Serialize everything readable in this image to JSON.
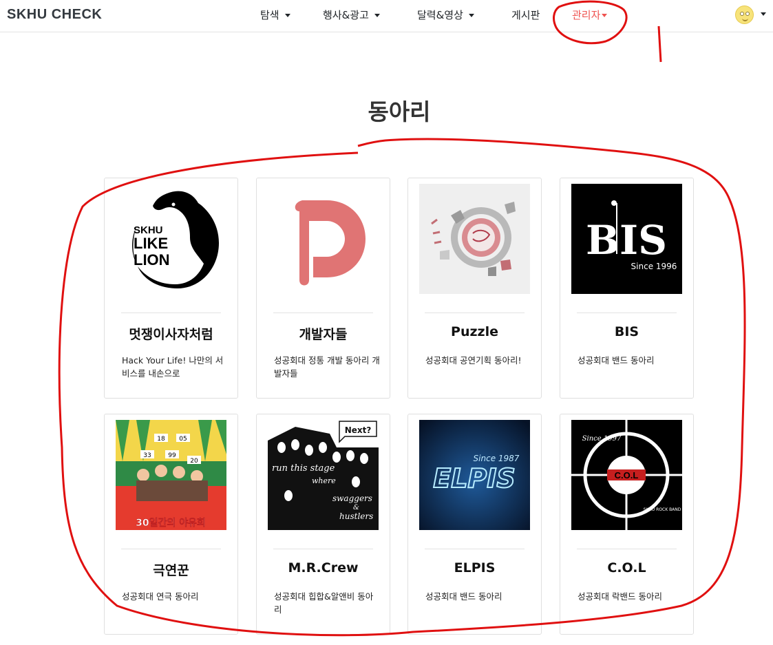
{
  "navbar": {
    "brand": "SKHU CHECK",
    "items": [
      {
        "label": "탐색",
        "dropdown": true
      },
      {
        "label": "행사&광고",
        "dropdown": true
      },
      {
        "label": "달력&영상",
        "dropdown": true
      },
      {
        "label": "게시판",
        "dropdown": false
      },
      {
        "label": "관리자",
        "dropdown": true,
        "active": true
      }
    ],
    "avatar_icon": "smiley-avatar-icon",
    "accent_color": "#ef5350"
  },
  "page": {
    "title": "동아리"
  },
  "clubs": [
    {
      "name": "멋쟁이사자처럼",
      "desc": "Hack Your Life! 나만의 서비스를 내손으로",
      "logo_text": [
        "SKHU",
        "LIKE",
        "LION"
      ]
    },
    {
      "name": "개발자들",
      "desc": "성공회대 정통 개발 동아리 개발자들",
      "logo_text": []
    },
    {
      "name": "Puzzle",
      "desc": "성공회대 공연기획 동아리!",
      "logo_text": []
    },
    {
      "name": "BIS",
      "desc": "성공회대 밴드 동아리",
      "logo_text": [
        "BIS",
        "Since 1996"
      ]
    },
    {
      "name": "극연꾼",
      "desc": "성공회대 연극 동아리",
      "logo_text": [
        "30일간의 야유회",
        "18",
        "05",
        "33",
        "99",
        "20"
      ]
    },
    {
      "name": "M.R.Crew",
      "desc": "성공회대 힙합&알앤비 동아리",
      "logo_text": [
        "Next?",
        "run this stage",
        "where",
        "swaggers",
        "&",
        "hustlers"
      ]
    },
    {
      "name": "ELPIS",
      "desc": "성공회대 밴드 동아리",
      "logo_text": [
        "Since 1987",
        "ELPIS"
      ]
    },
    {
      "name": "C.O.L",
      "desc": "성공회대 락밴드 동아리",
      "logo_text": [
        "Since 1997",
        "C.O.L",
        "SKHU ROCK BAND"
      ]
    }
  ]
}
